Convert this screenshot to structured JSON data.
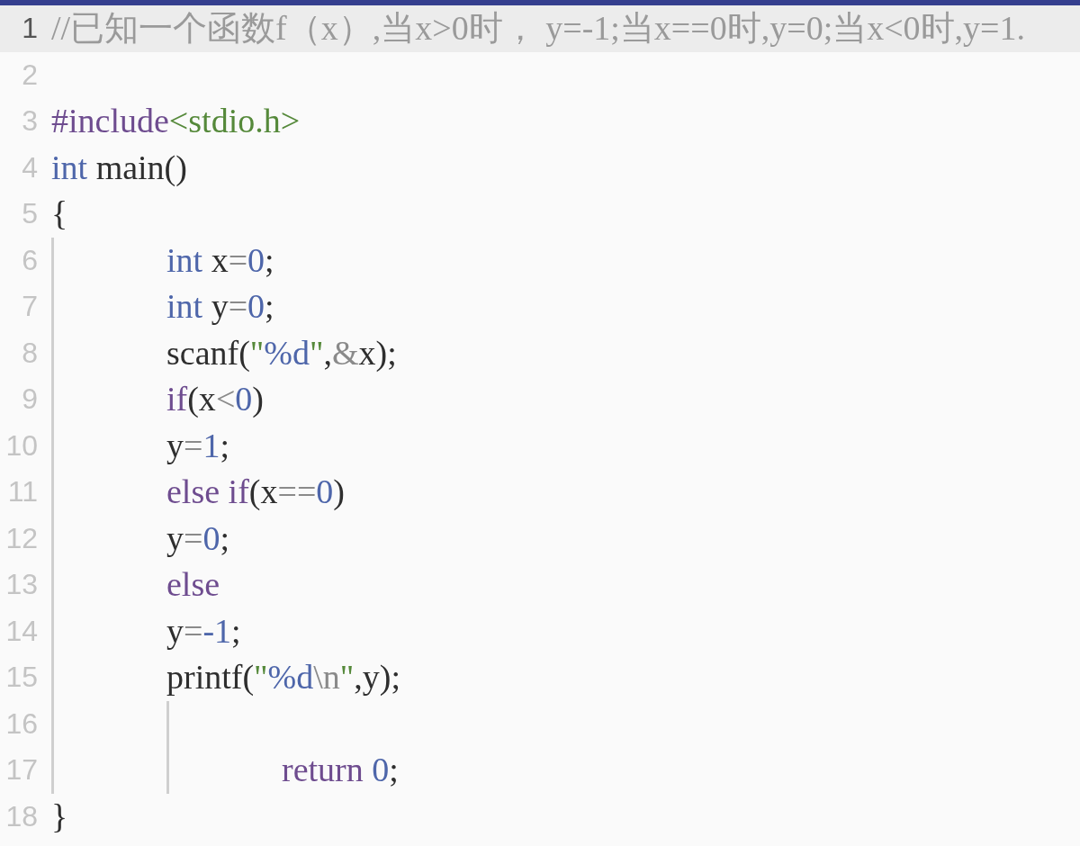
{
  "editor": {
    "lines": [
      {
        "kind": "line",
        "number": "1",
        "selected": true,
        "tokens": [
          {
            "text": "//已知一个函数f（x）,当x>0时， y=-1;当x==0时,y=0;当x<0时,y=1.",
            "kind": "comment"
          }
        ]
      },
      {
        "kind": "line",
        "number": "2",
        "selected": false
      },
      {
        "kind": "line",
        "number": "3",
        "selected": false,
        "tokens": [
          {
            "text": "#include",
            "kind": "keyword"
          },
          {
            "text": "<stdio.h>",
            "kind": "string"
          }
        ]
      },
      {
        "kind": "line",
        "number": "4",
        "selected": false,
        "tokens": [
          {
            "text": "int",
            "kind": "type"
          },
          {
            "text": " main()",
            "kind": "plain"
          }
        ]
      },
      {
        "kind": "line",
        "number": "5",
        "selected": false,
        "tokens": [
          {
            "text": "{",
            "kind": "plain"
          }
        ]
      },
      {
        "kind": "block",
        "children": [
          {
            "kind": "line",
            "number": "6",
            "selected": false,
            "tokens": [
              {
                "text": "int",
                "kind": "type"
              },
              {
                "text": " x",
                "kind": "plain"
              },
              {
                "text": "=",
                "kind": "operator"
              },
              {
                "text": "0",
                "kind": "number"
              },
              {
                "text": ";",
                "kind": "plain"
              }
            ]
          },
          {
            "kind": "line",
            "number": "7",
            "selected": false,
            "tokens": [
              {
                "text": "int",
                "kind": "type"
              },
              {
                "text": " y",
                "kind": "plain"
              },
              {
                "text": "=",
                "kind": "operator"
              },
              {
                "text": "0",
                "kind": "number"
              },
              {
                "text": ";",
                "kind": "plain"
              }
            ]
          },
          {
            "kind": "line",
            "number": "8",
            "selected": false,
            "tokens": [
              {
                "text": "scanf(",
                "kind": "plain"
              },
              {
                "text": "\"",
                "kind": "string"
              },
              {
                "text": "%d",
                "kind": "number"
              },
              {
                "text": "\"",
                "kind": "string"
              },
              {
                "text": ",",
                "kind": "plain"
              },
              {
                "text": "&",
                "kind": "operator"
              },
              {
                "text": "x);",
                "kind": "plain"
              }
            ]
          },
          {
            "kind": "line",
            "number": "9",
            "selected": false,
            "tokens": [
              {
                "text": "if",
                "kind": "keyword"
              },
              {
                "text": "(x",
                "kind": "plain"
              },
              {
                "text": "<",
                "kind": "operator"
              },
              {
                "text": "0",
                "kind": "number"
              },
              {
                "text": ")",
                "kind": "plain"
              }
            ]
          },
          {
            "kind": "line",
            "number": "10",
            "selected": false,
            "tokens": [
              {
                "text": "y",
                "kind": "plain"
              },
              {
                "text": "=",
                "kind": "operator"
              },
              {
                "text": "1",
                "kind": "number"
              },
              {
                "text": ";",
                "kind": "plain"
              }
            ]
          },
          {
            "kind": "line",
            "number": "11",
            "selected": false,
            "tokens": [
              {
                "text": "else if",
                "kind": "keyword"
              },
              {
                "text": "(x",
                "kind": "plain"
              },
              {
                "text": "==",
                "kind": "operator"
              },
              {
                "text": "0",
                "kind": "number"
              },
              {
                "text": ")",
                "kind": "plain"
              }
            ]
          },
          {
            "kind": "line",
            "number": "12",
            "selected": false,
            "tokens": [
              {
                "text": "y",
                "kind": "plain"
              },
              {
                "text": "=",
                "kind": "operator"
              },
              {
                "text": "0",
                "kind": "number"
              },
              {
                "text": ";",
                "kind": "plain"
              }
            ]
          },
          {
            "kind": "line",
            "number": "13",
            "selected": false,
            "tokens": [
              {
                "text": "else",
                "kind": "keyword"
              }
            ]
          },
          {
            "kind": "line",
            "number": "14",
            "selected": false,
            "tokens": [
              {
                "text": "y",
                "kind": "plain"
              },
              {
                "text": "=",
                "kind": "operator"
              },
              {
                "text": "-1",
                "kind": "number"
              },
              {
                "text": ";",
                "kind": "plain"
              }
            ]
          },
          {
            "kind": "line",
            "number": "15",
            "selected": false,
            "tokens": [
              {
                "text": "printf(",
                "kind": "plain"
              },
              {
                "text": "\"",
                "kind": "string"
              },
              {
                "text": "%d",
                "kind": "number"
              },
              {
                "text": "\\n",
                "kind": "operator"
              },
              {
                "text": "\"",
                "kind": "string"
              },
              {
                "text": ",y);",
                "kind": "plain"
              }
            ]
          },
          {
            "kind": "block",
            "children": [
              {
                "kind": "line",
                "number": "16",
                "selected": false
              },
              {
                "kind": "line",
                "number": "17",
                "selected": false,
                "tokens": [
                  {
                    "text": "return",
                    "kind": "keyword"
                  },
                  {
                    "text": " 0",
                    "kind": "number"
                  },
                  {
                    "text": ";",
                    "kind": "plain"
                  }
                ]
              }
            ]
          }
        ]
      },
      {
        "kind": "line",
        "number": "18",
        "selected": false,
        "tokens": [
          {
            "text": "}",
            "kind": "plain"
          }
        ]
      }
    ]
  }
}
